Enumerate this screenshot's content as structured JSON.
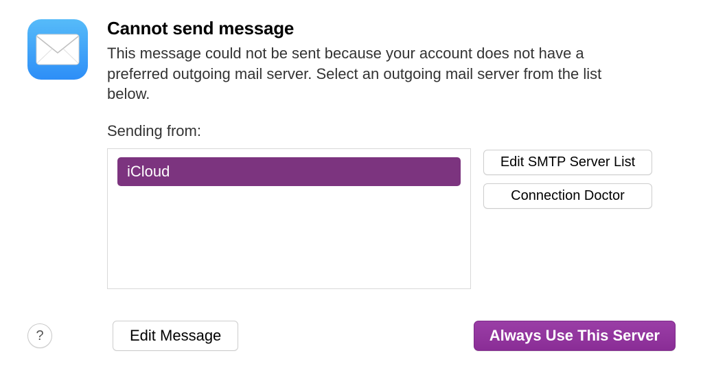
{
  "title": "Cannot send message",
  "body": "This message could not be sent because your account does not have a preferred outgoing mail server. Select an outgoing mail server from the list below.",
  "sending_from_label": "Sending from:",
  "servers": {
    "selected": "iCloud"
  },
  "buttons": {
    "edit_smtp": "Edit SMTP Server List",
    "connection_doctor": "Connection Doctor",
    "edit_message": "Edit Message",
    "always_use": "Always Use This Server",
    "help": "?"
  }
}
